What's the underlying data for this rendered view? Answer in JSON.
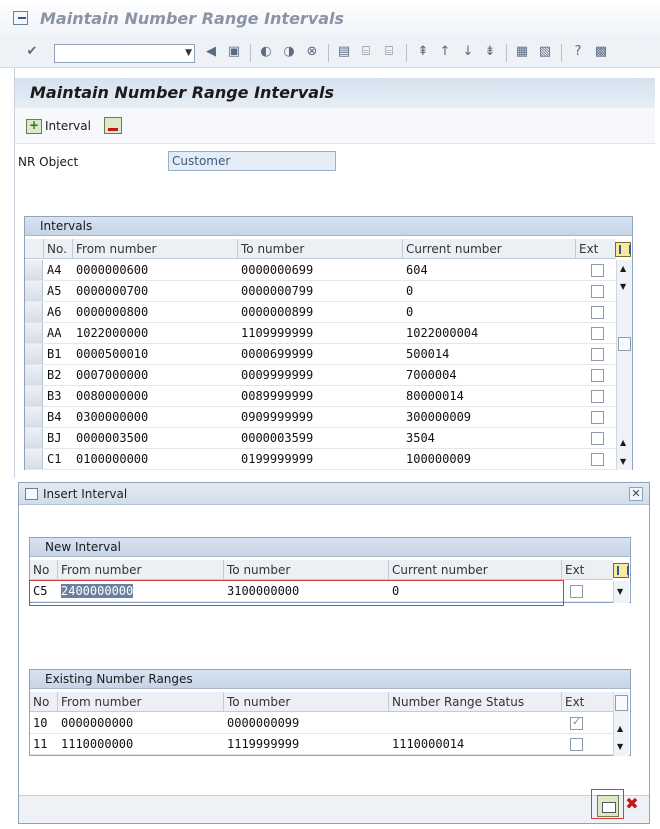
{
  "window": {
    "title": "Maintain Number Range Intervals"
  },
  "toolbar": {
    "icons": [
      "enter-icon",
      "save-icon",
      "back-icon",
      "exit-icon",
      "cancel-icon",
      "print-icon",
      "find-icon",
      "find-next-icon",
      "first-page-icon",
      "previous-page-icon",
      "next-page-icon",
      "last-page-icon",
      "new-session-icon",
      "shortcut-icon",
      "help-icon",
      "customize-icon"
    ],
    "command_value": ""
  },
  "app": {
    "title": "Maintain Number Range Intervals",
    "buttons": {
      "interval_label": "Interval"
    },
    "nr_object_label": "NR Object",
    "nr_object_value": "Customer"
  },
  "intervals": {
    "title": "Intervals",
    "columns": [
      "No.",
      "From number",
      "To number",
      "Current number",
      "Ext"
    ],
    "rows": [
      {
        "no": "A4",
        "from": "0000000600",
        "to": "0000000699",
        "current": "604",
        "ext": false
      },
      {
        "no": "A5",
        "from": "0000000700",
        "to": "0000000799",
        "current": "0",
        "ext": false
      },
      {
        "no": "A6",
        "from": "0000000800",
        "to": "0000000899",
        "current": "0",
        "ext": false
      },
      {
        "no": "AA",
        "from": "1022000000",
        "to": "1109999999",
        "current": "1022000004",
        "ext": false
      },
      {
        "no": "B1",
        "from": "0000500010",
        "to": "0000699999",
        "current": "500014",
        "ext": false
      },
      {
        "no": "B2",
        "from": "0007000000",
        "to": "0009999999",
        "current": "7000004",
        "ext": false
      },
      {
        "no": "B3",
        "from": "0080000000",
        "to": "0089999999",
        "current": "80000014",
        "ext": false
      },
      {
        "no": "B4",
        "from": "0300000000",
        "to": "0909999999",
        "current": "300000009",
        "ext": false
      },
      {
        "no": "BJ",
        "from": "0000003500",
        "to": "0000003599",
        "current": "3504",
        "ext": false
      },
      {
        "no": "C1",
        "from": "0100000000",
        "to": "0199999999",
        "current": "100000009",
        "ext": false
      }
    ]
  },
  "dialog": {
    "title": "Insert Interval",
    "new_interval": {
      "title": "New Interval",
      "columns": [
        "No",
        "From number",
        "To number",
        "Current number",
        "Ext"
      ],
      "row": {
        "no": "C5",
        "from": "2400000000",
        "to": "3100000000",
        "current": "0",
        "ext": false
      }
    },
    "existing": {
      "title": "Existing Number Ranges",
      "columns": [
        "No",
        "From number",
        "To number",
        "Number Range Status",
        "Ext"
      ],
      "rows": [
        {
          "no": "10",
          "from": "0000000000",
          "to": "0000000099",
          "status": "",
          "ext": true
        },
        {
          "no": "11",
          "from": "1110000000",
          "to": "1119999999",
          "status": "1110000014",
          "ext": false
        }
      ]
    }
  }
}
